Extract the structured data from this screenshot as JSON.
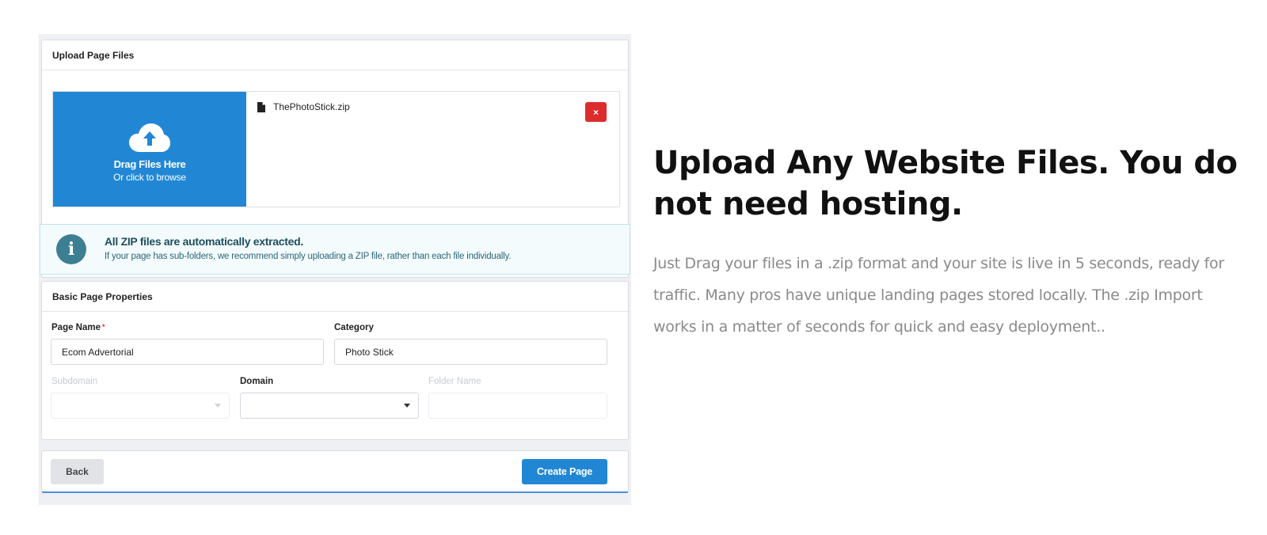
{
  "upload": {
    "title": "Upload Page Files",
    "dropzone_title": "Drag Files Here",
    "dropzone_sub": "Or click to browse",
    "file_name": "ThePhotoStick.zip",
    "remove_label": "×"
  },
  "info": {
    "title": "All ZIP files are automatically extracted.",
    "text": "If your page has sub-folders, we recommend simply uploading a ZIP file, rather than each file individually."
  },
  "properties": {
    "title": "Basic Page Properties",
    "page_name_label": "Page Name",
    "required_mark": "*",
    "page_name_value": "Ecom Advertorial",
    "category_label": "Category",
    "category_value": "Photo Stick",
    "subdomain_label": "Subdomain",
    "domain_label": "Domain",
    "folder_label": "Folder Name"
  },
  "footer": {
    "back_label": "Back",
    "create_label": "Create Page"
  },
  "marketing": {
    "headline": "Upload Any Website Files. You do not need hosting.",
    "description": "Just Drag your files in a .zip format and your site is live in 5 seconds, ready for traffic. Many pros have unique landing pages stored locally. The .zip Import works in a matter of seconds for quick and easy deployment.."
  },
  "colors": {
    "primary": "#2187d5",
    "danger": "#dd2c2c",
    "info_icon": "#3d7f92"
  },
  "icons": [
    "cloud-upload-icon",
    "file-icon",
    "close-icon",
    "info-icon",
    "chevron-down-icon"
  ]
}
